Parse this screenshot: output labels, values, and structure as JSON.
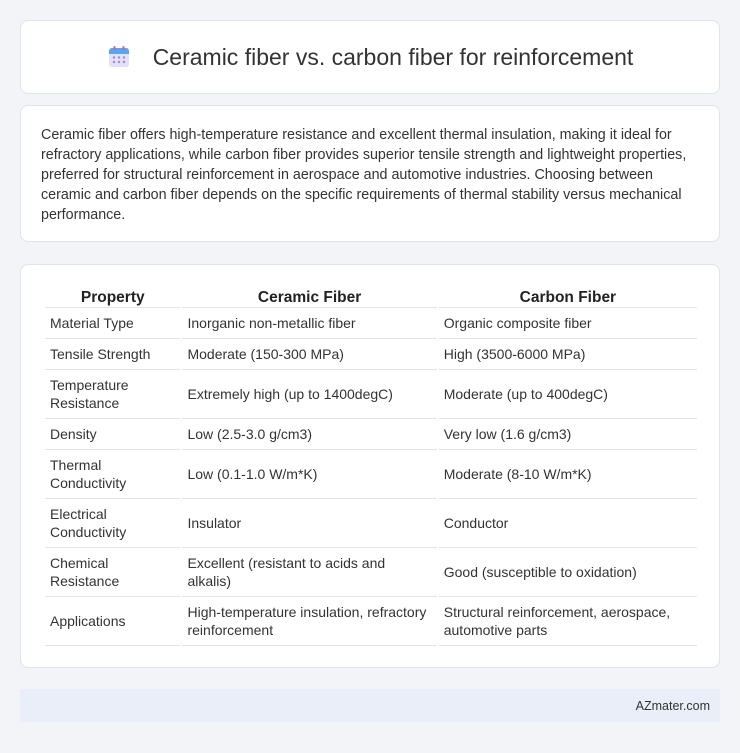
{
  "header": {
    "title": "Ceramic fiber vs. carbon fiber for reinforcement",
    "icon": "calendar-icon"
  },
  "description": "Ceramic fiber offers high-temperature resistance and excellent thermal insulation, making it ideal for refractory applications, while carbon fiber provides superior tensile strength and lightweight properties, preferred for structural reinforcement in aerospace and automotive industries. Choosing between ceramic and carbon fiber depends on the specific requirements of thermal stability versus mechanical performance.",
  "table": {
    "headers": [
      "Property",
      "Ceramic Fiber",
      "Carbon Fiber"
    ],
    "rows": [
      [
        "Material Type",
        "Inorganic non-metallic fiber",
        "Organic composite fiber"
      ],
      [
        "Tensile Strength",
        "Moderate (150-300 MPa)",
        "High (3500-6000 MPa)"
      ],
      [
        "Temperature Resistance",
        "Extremely high (up to 1400degC)",
        "Moderate (up to 400degC)"
      ],
      [
        "Density",
        "Low (2.5-3.0 g/cm3)",
        "Very low (1.6 g/cm3)"
      ],
      [
        "Thermal Conductivity",
        "Low (0.1-1.0 W/m*K)",
        "Moderate (8-10 W/m*K)"
      ],
      [
        "Electrical Conductivity",
        "Insulator",
        "Conductor"
      ],
      [
        "Chemical Resistance",
        "Excellent (resistant to acids and alkalis)",
        "Good (susceptible to oxidation)"
      ],
      [
        "Applications",
        "High-temperature insulation, refractory reinforcement",
        "Structural reinforcement, aerospace, automotive parts"
      ]
    ]
  },
  "footer": {
    "brand": "AZmater.com"
  }
}
